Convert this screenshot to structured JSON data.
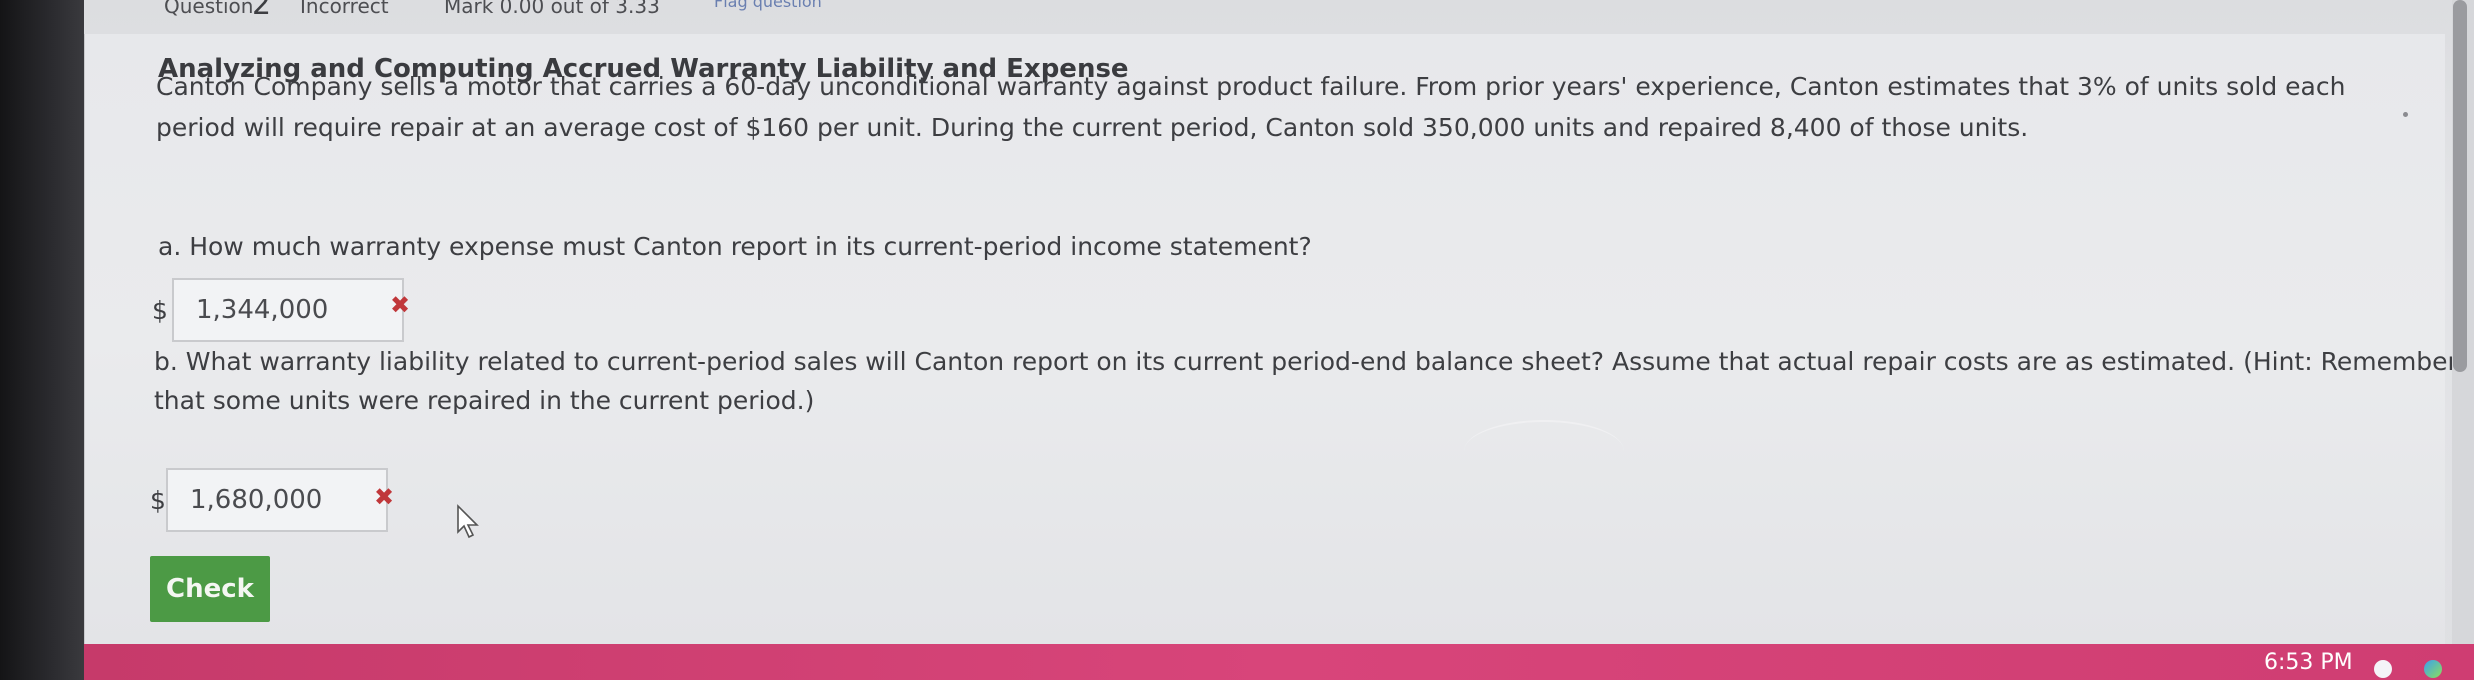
{
  "header": {
    "question_label": "Question",
    "question_number": "2",
    "status": "Incorrect",
    "mark": "Mark 0.00 out of 3.33",
    "flag": "Flag question"
  },
  "problem": {
    "title": "Analyzing and Computing Accrued Warranty Liability and Expense",
    "description": "Canton Company sells a motor that carries a 60-day unconditional warranty against product failure. From prior years' experience, Canton estimates that 3% of units sold each period will require repair at an average cost of $160 per unit. During the current period, Canton sold 350,000 units and repaired 8,400 of those units."
  },
  "part_a": {
    "question": "a. How much warranty expense must Canton report in its current-period income statement?",
    "currency": "$",
    "answer": "1,344,000",
    "result_icon": "✖"
  },
  "part_b": {
    "question": "b. What warranty liability related to current-period sales will Canton report on its current period-end balance sheet? Assume that actual repair costs are as estimated. (Hint: Remember that some units were repaired in the current period.)",
    "currency": "$",
    "answer": "1,680,000",
    "result_icon": "✖"
  },
  "actions": {
    "check_label": "Check"
  },
  "taskbar": {
    "time": "6:53 PM"
  },
  "colors": {
    "check_button": "#4c9a45",
    "incorrect_mark": "#c0373a",
    "taskbar": "#d8457a"
  }
}
